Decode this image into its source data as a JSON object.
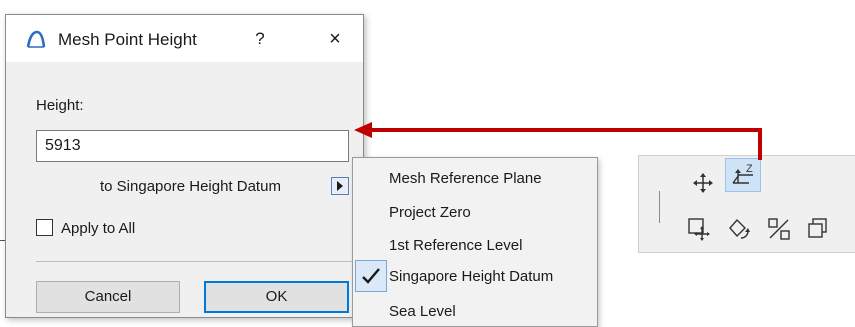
{
  "dialog": {
    "title": "Mesh Point Height",
    "help_label": "?",
    "close_label": "×",
    "height_label": "Height:",
    "height_value": "5913",
    "datum_label": "to Singapore Height Datum",
    "apply_label": "Apply to All",
    "apply_checked": false,
    "cancel_label": "Cancel",
    "ok_label": "OK"
  },
  "menu": {
    "items": [
      "Mesh Reference Plane",
      "Project Zero",
      "1st Reference Level",
      "Singapore Height Datum",
      "Sea Level"
    ],
    "selected": "Singapore Height Datum"
  },
  "toolbar": {
    "icons": [
      "move-icon",
      "elevate-icon",
      "drag-copy-icon",
      "rotate-icon",
      "mirror-icon",
      "multiply-icon"
    ],
    "active": "elevate-icon"
  },
  "colors": {
    "arrow": "#c00000",
    "accent": "#0078d7",
    "highlight": "#cfe3f7"
  }
}
